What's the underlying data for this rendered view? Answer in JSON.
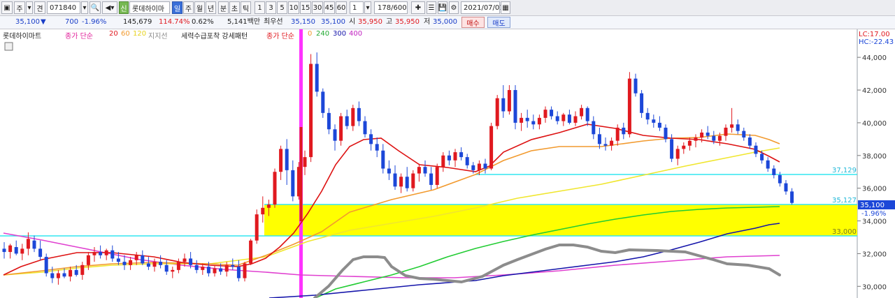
{
  "toolbar": {
    "btn_a": "주",
    "btn_b": "견",
    "code": "071840",
    "credit_badge": "신",
    "stock_name": "롯데하이마",
    "periods": [
      "일",
      "주",
      "월",
      "년",
      "분",
      "초",
      "틱"
    ],
    "selected_period": "일",
    "intervals": [
      "1",
      "3",
      "5",
      "10",
      "15",
      "30",
      "45",
      "60"
    ],
    "interval_value": "1",
    "count": "178",
    "count_total": "/600",
    "date": "2021/07/01"
  },
  "quote": {
    "price": "35,100",
    "change": "700",
    "change_pct": "-1.96%",
    "volume": "145,679",
    "vol_ratio": "114.74%",
    "turnover": "0.62%",
    "amount": "5,141백만",
    "best_label": "최우선",
    "best_ask": "35,150",
    "best_bid": "35,100",
    "open_label": "시",
    "open": "35,950",
    "high_label": "고",
    "high": "35,950",
    "low_label": "저",
    "low": "35,000",
    "buy": "매수",
    "sell": "매도"
  },
  "legend": {
    "name": "롯데하이마트",
    "ma1_label": "종가 단순",
    "ma1_p1": "20",
    "ma1_p2": "60",
    "ma1_p3": "120",
    "support": "지지선",
    "pattern": "세력수급포착 강세패턴",
    "ma2_label": "종가 단순",
    "ma2_p0": "0",
    "ma2_p1": "240",
    "ma2_p2": "300",
    "ma2_p3": "400"
  },
  "axis": {
    "lc": "LC:17.00",
    "hc": "HC:-22.43",
    "ticks": [
      "44,000",
      "42,000",
      "40,000",
      "38,000",
      "36,000",
      "34,000",
      "32,000",
      "30,000"
    ],
    "current": "35,100",
    "current_pct": "-1.96%"
  },
  "levels": {
    "upper": "37,129",
    "middle": "35,127",
    "lower": "33,000"
  },
  "colors": {
    "up": "#e0191f",
    "down": "#1c47d8",
    "band": "#ffff00",
    "signal": "#ff33ff",
    "level": "#33e6f0"
  },
  "chart_data": {
    "type": "candlestick",
    "ylim": [
      29500,
      45500
    ],
    "candles": [
      [
        32300,
        32700,
        31700,
        32100
      ],
      [
        32100,
        32600,
        31700,
        32500
      ],
      [
        32400,
        32800,
        31900,
        32000
      ],
      [
        32000,
        32600,
        31600,
        32300
      ],
      [
        32300,
        33300,
        31900,
        32900
      ],
      [
        32800,
        33100,
        32100,
        32300
      ],
      [
        32300,
        32800,
        31600,
        31800
      ],
      [
        31800,
        32000,
        30600,
        30800
      ],
      [
        30800,
        31200,
        30200,
        30500
      ],
      [
        30500,
        31000,
        30100,
        30800
      ],
      [
        30800,
        31100,
        30500,
        30600
      ],
      [
        30600,
        31200,
        30300,
        31000
      ],
      [
        31000,
        31300,
        30600,
        30700
      ],
      [
        30700,
        31500,
        30400,
        31300
      ],
      [
        31300,
        32100,
        31000,
        31900
      ],
      [
        31900,
        32400,
        31500,
        32100
      ],
      [
        32100,
        32500,
        31700,
        31900
      ],
      [
        31900,
        32300,
        31600,
        32200
      ],
      [
        32200,
        32500,
        31500,
        31700
      ],
      [
        31700,
        32100,
        31300,
        31500
      ],
      [
        31500,
        31900,
        31000,
        31300
      ],
      [
        31300,
        31800,
        31000,
        31600
      ],
      [
        31600,
        32100,
        31300,
        31900
      ],
      [
        31900,
        32200,
        31300,
        31400
      ],
      [
        31400,
        31800,
        31000,
        31200
      ],
      [
        31200,
        31700,
        30900,
        31500
      ],
      [
        31500,
        31900,
        31100,
        31300
      ],
      [
        31300,
        31600,
        30700,
        30900
      ],
      [
        30900,
        31200,
        30500,
        31000
      ],
      [
        31000,
        31700,
        30800,
        31500
      ],
      [
        31500,
        32000,
        31200,
        31700
      ],
      [
        31700,
        32100,
        31100,
        31300
      ],
      [
        31300,
        31600,
        30800,
        31000
      ],
      [
        31000,
        31400,
        30700,
        31200
      ],
      [
        31200,
        31500,
        30600,
        30800
      ],
      [
        30800,
        31300,
        30600,
        31100
      ],
      [
        31100,
        31400,
        30700,
        30900
      ],
      [
        30900,
        31500,
        30600,
        31300
      ],
      [
        31300,
        31700,
        31000,
        31200
      ],
      [
        31200,
        31600,
        30300,
        30500
      ],
      [
        30500,
        31500,
        30300,
        31400
      ],
      [
        31400,
        32900,
        31300,
        32800
      ],
      [
        32800,
        34700,
        32600,
        34400
      ],
      [
        34400,
        35500,
        33900,
        34800
      ],
      [
        34800,
        35300,
        34300,
        35000
      ],
      [
        35000,
        37200,
        34800,
        37000
      ],
      [
        37000,
        38600,
        36500,
        38400
      ],
      [
        38400,
        39000,
        36200,
        37100
      ],
      [
        37100,
        37700,
        35200,
        35500
      ],
      [
        35500,
        37600,
        35300,
        37300
      ],
      [
        37300,
        38300,
        36800,
        37900
      ],
      [
        37900,
        44200,
        37600,
        43600
      ],
      [
        43600,
        44300,
        41600,
        41900
      ],
      [
        41900,
        42100,
        40300,
        40600
      ],
      [
        40600,
        40900,
        39300,
        39600
      ],
      [
        39600,
        39900,
        38300,
        38900
      ],
      [
        38900,
        40600,
        38600,
        40400
      ],
      [
        40400,
        40800,
        39600,
        39800
      ],
      [
        39800,
        41100,
        39500,
        40900
      ],
      [
        40900,
        41300,
        39800,
        40100
      ],
      [
        40100,
        40400,
        39100,
        39300
      ],
      [
        39300,
        39600,
        38300,
        38700
      ],
      [
        38700,
        39100,
        37900,
        38300
      ],
      [
        38300,
        38700,
        36900,
        37200
      ],
      [
        37200,
        37700,
        36500,
        36900
      ],
      [
        36900,
        37400,
        35900,
        36100
      ],
      [
        36100,
        36900,
        35700,
        36700
      ],
      [
        36700,
        37300,
        35800,
        36000
      ],
      [
        36000,
        37100,
        35800,
        36900
      ],
      [
        36900,
        37500,
        36400,
        37300
      ],
      [
        37300,
        37700,
        36700,
        36900
      ],
      [
        36900,
        37300,
        35900,
        36200
      ],
      [
        36200,
        37500,
        36000,
        37300
      ],
      [
        37300,
        38200,
        37000,
        38000
      ],
      [
        38000,
        38300,
        37400,
        37700
      ],
      [
        37700,
        38400,
        37300,
        38200
      ],
      [
        38200,
        38500,
        37700,
        37900
      ],
      [
        37900,
        38100,
        37200,
        37400
      ],
      [
        37400,
        37600,
        36900,
        37100
      ],
      [
        37100,
        37700,
        36800,
        37500
      ],
      [
        37500,
        37800,
        36900,
        37200
      ],
      [
        37200,
        40000,
        37100,
        39800
      ],
      [
        39800,
        41700,
        39600,
        41500
      ],
      [
        41500,
        42300,
        40300,
        40700
      ],
      [
        40700,
        42300,
        40500,
        42000
      ],
      [
        42000,
        42300,
        39600,
        40000
      ],
      [
        40000,
        40600,
        39500,
        40300
      ],
      [
        40300,
        40800,
        39700,
        40100
      ],
      [
        40100,
        40500,
        39600,
        39900
      ],
      [
        39900,
        40500,
        39600,
        40300
      ],
      [
        40300,
        41000,
        40000,
        40800
      ],
      [
        40800,
        41000,
        40200,
        40400
      ],
      [
        40400,
        40700,
        39900,
        40100
      ],
      [
        40100,
        40600,
        39800,
        40500
      ],
      [
        40500,
        40800,
        39900,
        40000
      ],
      [
        40000,
        40700,
        39800,
        40400
      ],
      [
        40400,
        41100,
        40200,
        40900
      ],
      [
        40900,
        41000,
        39800,
        40100
      ],
      [
        40100,
        40400,
        39000,
        39300
      ],
      [
        39300,
        39700,
        38400,
        38700
      ],
      [
        38700,
        39100,
        38300,
        38600
      ],
      [
        38600,
        39100,
        38300,
        38900
      ],
      [
        38900,
        39900,
        38600,
        39700
      ],
      [
        39700,
        40000,
        39000,
        39300
      ],
      [
        39300,
        43100,
        39100,
        42700
      ],
      [
        42700,
        43000,
        41600,
        41800
      ],
      [
        41800,
        42000,
        40300,
        40600
      ],
      [
        40600,
        40900,
        39900,
        40200
      ],
      [
        40200,
        40500,
        39700,
        40000
      ],
      [
        40000,
        40400,
        39500,
        39700
      ],
      [
        39700,
        39900,
        38800,
        39000
      ],
      [
        39000,
        39300,
        37600,
        37800
      ],
      [
        37800,
        38600,
        37400,
        38400
      ],
      [
        38400,
        38800,
        38100,
        38600
      ],
      [
        38600,
        39100,
        38300,
        38900
      ],
      [
        38900,
        39300,
        38500,
        39100
      ],
      [
        39100,
        39600,
        38800,
        39400
      ],
      [
        39400,
        39800,
        39000,
        39200
      ],
      [
        39200,
        39500,
        38700,
        38900
      ],
      [
        38900,
        39400,
        38600,
        39200
      ],
      [
        39200,
        39900,
        38900,
        39700
      ],
      [
        39700,
        40900,
        39400,
        39900
      ],
      [
        39900,
        40200,
        39300,
        39500
      ],
      [
        39500,
        39700,
        38900,
        39100
      ],
      [
        39100,
        39300,
        38400,
        38600
      ],
      [
        38600,
        38800,
        37900,
        38100
      ],
      [
        38100,
        38300,
        37500,
        37700
      ],
      [
        37700,
        37900,
        37000,
        37200
      ],
      [
        37200,
        37400,
        36600,
        36800
      ],
      [
        36800,
        37000,
        36100,
        36300
      ],
      [
        36300,
        36500,
        35600,
        35800
      ],
      [
        35800,
        36000,
        35000,
        35100
      ]
    ]
  }
}
